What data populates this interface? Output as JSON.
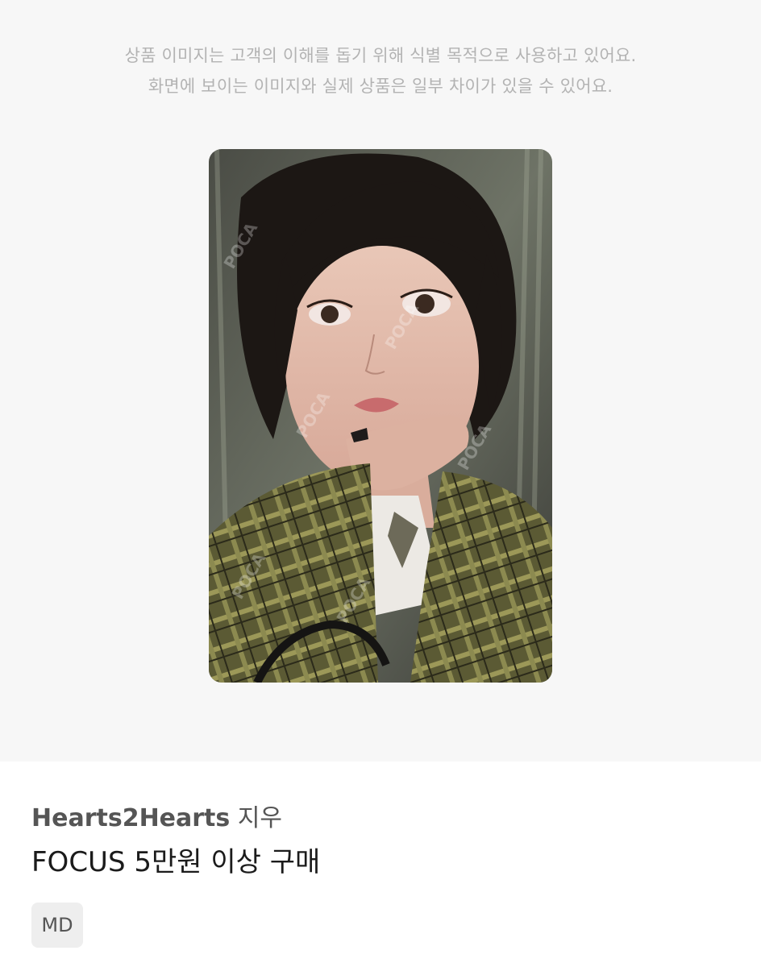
{
  "notice": {
    "line1": "상품 이미지는 고객의 이해를 돕기 위해 식별 목적으로 사용하고 있어요.",
    "line2": "화면에 보이는 이미지와 실제 상품은 일부 차이가 있을 수 있어요."
  },
  "product_image": {
    "watermark": "POCA 포카마켓"
  },
  "product": {
    "brand": "Hearts2Hearts",
    "member": "지우",
    "title": "FOCUS 5만원 이상 구매",
    "tag": "MD"
  },
  "colors": {
    "hero_background": "#f7f7f7",
    "notice_text": "#b3b3b3",
    "tag_background": "#eeeeee"
  }
}
